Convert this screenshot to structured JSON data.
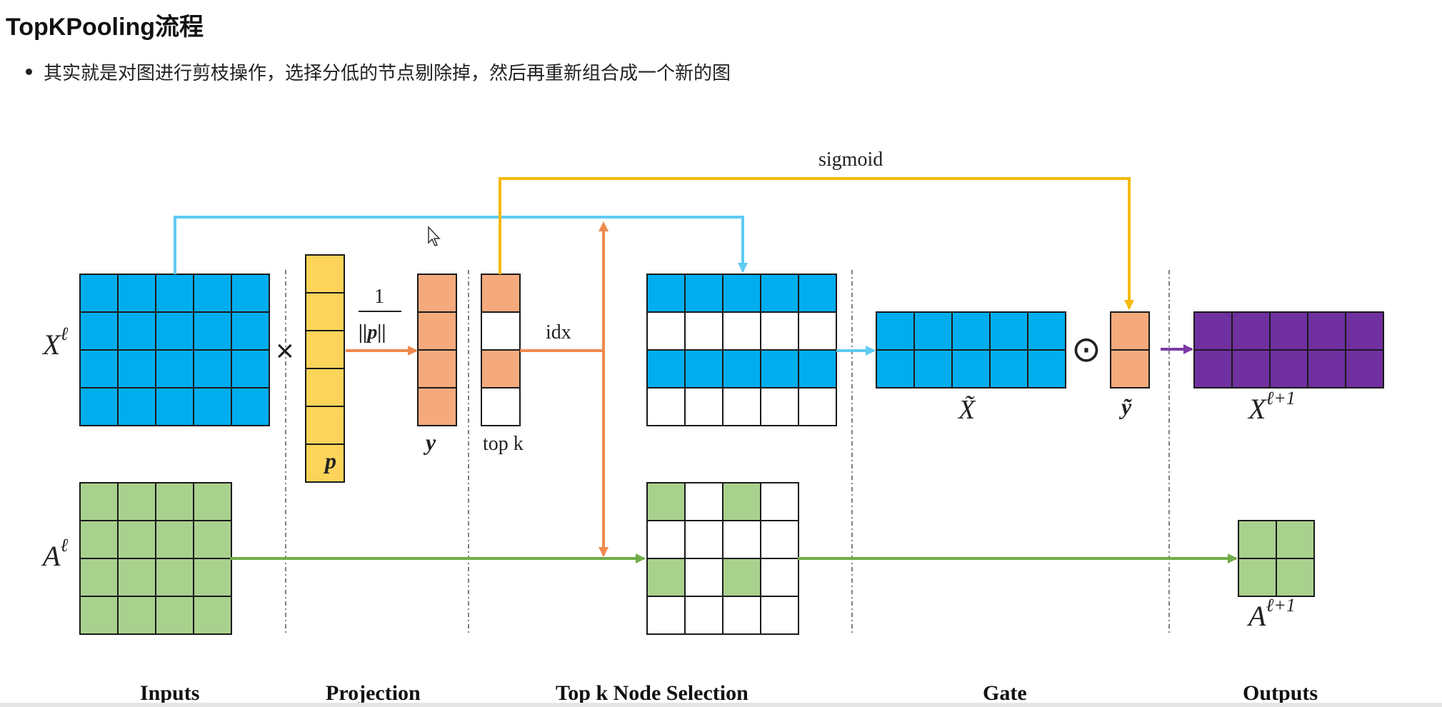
{
  "page": {
    "title": "TopKPooling流程",
    "bullet": "其实就是对图进行剪枝操作，选择分低的节点剔除掉，然后再重新组合成一个新的图"
  },
  "diagram": {
    "labels": {
      "x_in": "X",
      "x_in_sup": "ℓ",
      "a_in": "A",
      "a_in_sup": "ℓ",
      "times": "×",
      "p": "p",
      "frac_num": "1",
      "frac_den": "||p||",
      "y": "y",
      "topk": "top k",
      "idx": "idx",
      "sigmoid": "sigmoid",
      "x_tilde": "X̃",
      "odot": "⊙",
      "y_tilde": "ỹ",
      "x_out": "X",
      "x_out_sup": "ℓ+1",
      "a_out": "A",
      "a_out_sup": "ℓ+1"
    },
    "sections": [
      "Inputs",
      "Projection",
      "Top k Node Selection",
      "Gate",
      "Outputs"
    ],
    "colors": {
      "blue": "#00aeef",
      "yellow": "#fcd45a",
      "orange": "#f4aa7d",
      "green": "#a9d18e",
      "purple": "#7030a0",
      "arrow_blue": "#5ecbf2",
      "arrow_yellow": "#f5b90a",
      "arrow_orange": "#ef8a4e",
      "arrow_green": "#70ad47",
      "arrow_purple": "#7b3aa6"
    }
  }
}
